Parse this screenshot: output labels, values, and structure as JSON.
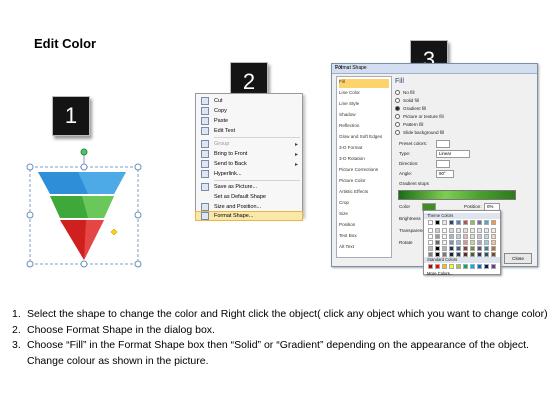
{
  "title": "Edit Color",
  "badges": [
    "1",
    "2",
    "3"
  ],
  "context_menu": {
    "items": [
      {
        "label": "Cut",
        "disabled": false
      },
      {
        "label": "Copy",
        "disabled": false
      },
      {
        "label": "Paste",
        "disabled": false
      },
      {
        "label": "Edit Text",
        "disabled": false
      },
      {
        "label": "Group",
        "disabled": true,
        "submenu": true
      },
      {
        "label": "Bring to Front",
        "disabled": false,
        "submenu": true
      },
      {
        "label": "Send to Back",
        "disabled": false,
        "submenu": true
      },
      {
        "label": "Hyperlink...",
        "disabled": false
      },
      {
        "label": "Save as Picture...",
        "disabled": false
      },
      {
        "label": "Set as Default Shape",
        "disabled": false
      },
      {
        "label": "Size and Position...",
        "disabled": false
      },
      {
        "label": "Format Shape...",
        "disabled": false,
        "highlighted": true
      }
    ]
  },
  "dialog": {
    "title": "Format Shape",
    "help": "? X",
    "categories": [
      "Fill",
      "Line Color",
      "Line Style",
      "Shadow",
      "Reflection",
      "Glow and Soft Edges",
      "3-D Format",
      "3-D Rotation",
      "Picture Corrections",
      "Picture Color",
      "Artistic Effects",
      "Crop",
      "Size",
      "Position",
      "Text Box",
      "Alt Text"
    ],
    "selected_category": "Fill",
    "fill_heading": "Fill",
    "fill_options": [
      "No fill",
      "Solid fill",
      "Gradient fill",
      "Picture or texture fill",
      "Pattern fill",
      "Slide background fill"
    ],
    "selected_fill": "Gradient fill",
    "fields": {
      "preset_label": "Preset colors:",
      "type_label": "Type:",
      "type_value": "Linear",
      "direction_label": "Direction:",
      "angle_label": "Angle:",
      "angle_value": "90°",
      "stops_label": "Gradient stops",
      "color_label": "Color",
      "position_label": "Position:",
      "position_value": "0%",
      "brightness_label": "Brightness",
      "transparency_label": "Transparency",
      "rotate_label": "Rotate"
    },
    "close_label": "Close"
  },
  "color_palette": {
    "theme_label": "Theme Colors",
    "standard_label": "Standard Colors",
    "more_label": "More Colors...",
    "theme_top": [
      "#ffffff",
      "#000000",
      "#eeece1",
      "#1f497d",
      "#4f81bd",
      "#c0504d",
      "#9bbb59",
      "#8064a2",
      "#4bacc6",
      "#f79646"
    ],
    "standard": [
      "#c00000",
      "#ff0000",
      "#ffc000",
      "#ffff00",
      "#92d050",
      "#00b050",
      "#00b0f0",
      "#0070c0",
      "#002060",
      "#7030a0"
    ]
  },
  "pyramid_colors": {
    "blue": "#2e8fd8",
    "green": "#3ea83a",
    "red": "#d01f1f"
  },
  "instructions": [
    {
      "num": "1.",
      "text": "Select the shape to change the color and Right click the object( click any object which you want to change color)"
    },
    {
      "num": "2.",
      "text": "Choose Format Shape in the dialog box."
    },
    {
      "num": "3.",
      "text": "Choose “Fill” in the Format Shape box then “Solid” or “Gradient” depending on the appearance of the object. Change colour as shown in the picture."
    }
  ]
}
